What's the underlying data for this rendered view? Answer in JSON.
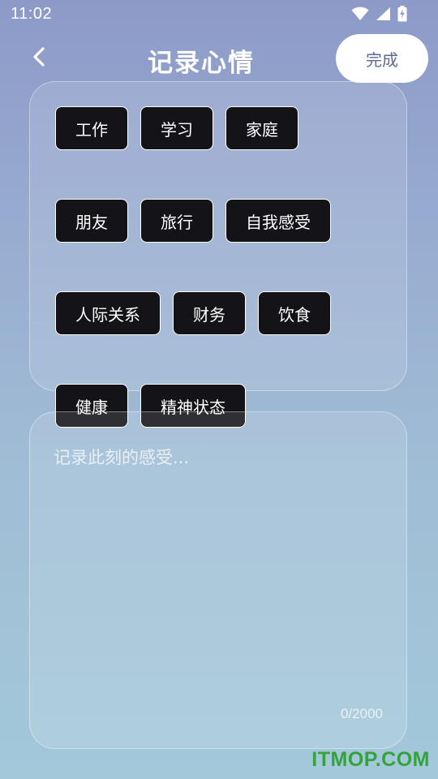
{
  "status_bar": {
    "time": "11:02",
    "icons": [
      "wifi-icon",
      "signal-icon",
      "battery-charging-icon"
    ]
  },
  "header": {
    "back_icon": "chevron-left-icon",
    "title": "记录心情",
    "done_label": "完成"
  },
  "tags": [
    {
      "label": "工作"
    },
    {
      "label": "学习"
    },
    {
      "label": "家庭"
    },
    {
      "label": "朋友"
    },
    {
      "label": "旅行"
    },
    {
      "label": "自我感受"
    },
    {
      "label": "人际关系"
    },
    {
      "label": "财务"
    },
    {
      "label": "饮食"
    },
    {
      "label": "健康"
    },
    {
      "label": "精神状态"
    }
  ],
  "note": {
    "placeholder": "记录此刻的感受...",
    "value": "",
    "counter": "0/2000"
  },
  "watermark": "ITMOP.COM",
  "colors": {
    "tag_background": "#141418",
    "done_text": "#5d6b93",
    "watermark": "#33a33a"
  }
}
